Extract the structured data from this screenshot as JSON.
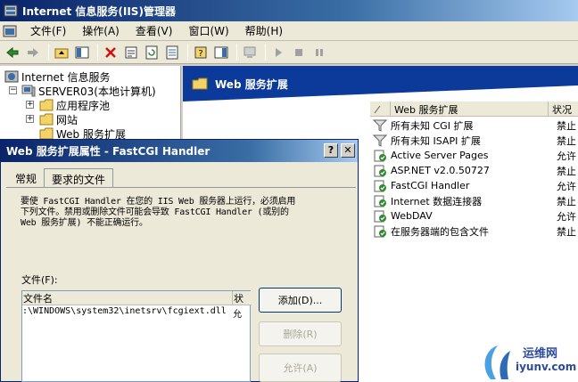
{
  "window": {
    "title": "Internet 信息服务(IIS)管理器"
  },
  "menu": [
    "文件(F)",
    "操作(A)",
    "查看(V)",
    "窗口(W)",
    "帮助(H)"
  ],
  "tree": {
    "root": "Internet 信息服务",
    "server": "SERVER03(本地计算机)",
    "children": [
      "应用程序池",
      "网站",
      "Web 服务扩展"
    ]
  },
  "right_pane": {
    "header": "Web 服务扩展"
  },
  "extensions": {
    "columns": [
      "Web 服务扩展",
      "状况"
    ],
    "rows": [
      {
        "name": "所有未知 CGI 扩展",
        "status": "禁止",
        "icon": "filter-icon"
      },
      {
        "name": "所有未知 ISAPI 扩展",
        "status": "禁止",
        "icon": "filter-icon"
      },
      {
        "name": "Active Server Pages",
        "status": "允许",
        "icon": "extension-icon"
      },
      {
        "name": "ASP.NET v2.0.50727",
        "status": "禁止",
        "icon": "extension-icon"
      },
      {
        "name": "FastCGI Handler",
        "status": "允许",
        "icon": "extension-icon"
      },
      {
        "name": "Internet 数据连接器",
        "status": "禁止",
        "icon": "extension-icon"
      },
      {
        "name": "WebDAV",
        "status": "允许",
        "icon": "extension-icon"
      },
      {
        "name": "在服务器端的包含文件",
        "status": "禁止",
        "icon": "extension-icon"
      }
    ]
  },
  "dialog": {
    "title": "Web 服务扩展属性 - FastCGI Handler",
    "help_label": "?",
    "close_label": "✕",
    "tabs": [
      "常规",
      "要求的文件"
    ],
    "desc_lines": [
      "要使 FastCGI Handler 在您的 IIS Web 服务器上运行，必须启用",
      "下列文件。禁用或删除文件可能会导致 FastCGI Handler (或别的",
      "Web 服务扩展) 不能正确运行。"
    ],
    "files_label": "文件(F):",
    "files_columns": [
      "文件名",
      "状"
    ],
    "files_rows": [
      {
        "name": ":\\WINDOWS\\system32\\inetsrv\\fcgiext.dll",
        "status": "允"
      }
    ],
    "buttons": {
      "add": "添加(D)...",
      "remove": "删除(R)",
      "allow": "允许(A)"
    }
  },
  "watermark": {
    "cn": "运维网",
    "en": "iyunv.com"
  }
}
